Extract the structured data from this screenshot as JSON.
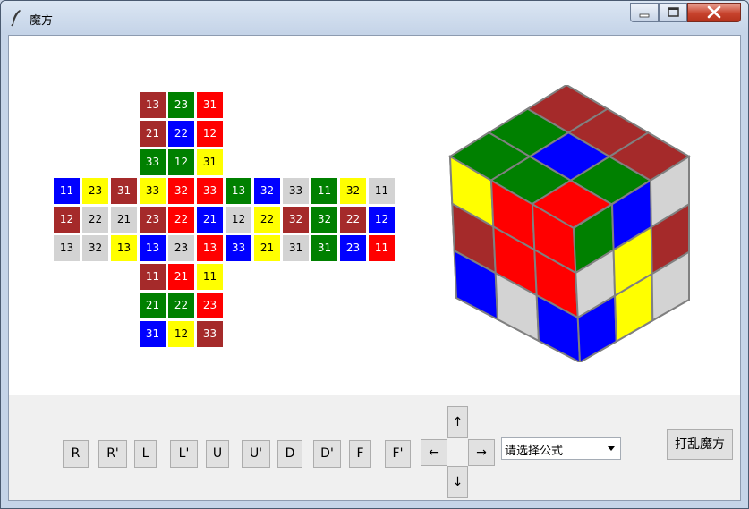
{
  "window": {
    "title": "魔方"
  },
  "net": {
    "rows": [
      {
        "row": 0,
        "col": 3,
        "cells": [
          {
            "t": "13",
            "c": "brown"
          },
          {
            "t": "23",
            "c": "green"
          },
          {
            "t": "31",
            "c": "red"
          }
        ]
      },
      {
        "row": 1,
        "col": 3,
        "cells": [
          {
            "t": "21",
            "c": "brown"
          },
          {
            "t": "22",
            "c": "blue"
          },
          {
            "t": "12",
            "c": "red"
          }
        ]
      },
      {
        "row": 2,
        "col": 3,
        "cells": [
          {
            "t": "33",
            "c": "green"
          },
          {
            "t": "12",
            "c": "green"
          },
          {
            "t": "31",
            "c": "yellow"
          }
        ]
      },
      {
        "row": 3,
        "col": 0,
        "cells": [
          {
            "t": "11",
            "c": "blue"
          },
          {
            "t": "23",
            "c": "yellow"
          },
          {
            "t": "31",
            "c": "brown"
          },
          {
            "t": "33",
            "c": "yellow"
          },
          {
            "t": "32",
            "c": "red"
          },
          {
            "t": "33",
            "c": "red"
          },
          {
            "t": "13",
            "c": "green"
          },
          {
            "t": "32",
            "c": "blue"
          },
          {
            "t": "33",
            "c": "gray"
          },
          {
            "t": "11",
            "c": "green"
          },
          {
            "t": "32",
            "c": "yellow"
          },
          {
            "t": "11",
            "c": "gray"
          }
        ]
      },
      {
        "row": 4,
        "col": 0,
        "cells": [
          {
            "t": "12",
            "c": "brown"
          },
          {
            "t": "22",
            "c": "gray"
          },
          {
            "t": "21",
            "c": "gray"
          },
          {
            "t": "23",
            "c": "brown"
          },
          {
            "t": "22",
            "c": "red"
          },
          {
            "t": "21",
            "c": "blue"
          },
          {
            "t": "12",
            "c": "gray"
          },
          {
            "t": "22",
            "c": "yellow"
          },
          {
            "t": "32",
            "c": "brown"
          },
          {
            "t": "32",
            "c": "green"
          },
          {
            "t": "22",
            "c": "brown"
          },
          {
            "t": "12",
            "c": "blue"
          }
        ]
      },
      {
        "row": 5,
        "col": 0,
        "cells": [
          {
            "t": "13",
            "c": "gray"
          },
          {
            "t": "32",
            "c": "gray"
          },
          {
            "t": "13",
            "c": "yellow"
          },
          {
            "t": "13",
            "c": "blue"
          },
          {
            "t": "23",
            "c": "gray"
          },
          {
            "t": "13",
            "c": "red"
          },
          {
            "t": "33",
            "c": "blue"
          },
          {
            "t": "21",
            "c": "yellow"
          },
          {
            "t": "31",
            "c": "gray"
          },
          {
            "t": "31",
            "c": "green"
          },
          {
            "t": "23",
            "c": "blue"
          },
          {
            "t": "11",
            "c": "red"
          }
        ]
      },
      {
        "row": 6,
        "col": 3,
        "cells": [
          {
            "t": "11",
            "c": "brown"
          },
          {
            "t": "21",
            "c": "red"
          },
          {
            "t": "11",
            "c": "yellow"
          }
        ]
      },
      {
        "row": 7,
        "col": 3,
        "cells": [
          {
            "t": "21",
            "c": "green"
          },
          {
            "t": "22",
            "c": "green"
          },
          {
            "t": "23",
            "c": "red"
          }
        ]
      },
      {
        "row": 8,
        "col": 3,
        "cells": [
          {
            "t": "31",
            "c": "blue"
          },
          {
            "t": "12",
            "c": "yellow"
          },
          {
            "t": "33",
            "c": "brown"
          }
        ]
      }
    ]
  },
  "cube3d": {
    "top": [
      "brown",
      "brown",
      "brown",
      "green",
      "blue",
      "green",
      "green",
      "green",
      "red",
      "red",
      "yellow",
      "red"
    ],
    "front": [
      "yellow",
      "red",
      "red",
      "brown",
      "red",
      "red",
      "blue",
      "gray",
      "blue",
      "gray",
      "red"
    ],
    "side": [
      "green",
      "blue",
      "gray",
      "gray",
      "yellow",
      "brown",
      "blue",
      "yellow",
      "gray"
    ]
  },
  "colors": {
    "brown": "#a52a2a",
    "green": "#008000",
    "red": "#ff0000",
    "blue": "#0000ff",
    "yellow": "#ffff00",
    "gray": "#d3d3d3",
    "frame": "#808080"
  },
  "controls": {
    "moves": [
      "R",
      "R'",
      "L",
      "L'",
      "U",
      "U'",
      "D",
      "D'",
      "F",
      "F'"
    ],
    "arrow_left": "←",
    "arrow_up": "↑",
    "arrow_right": "→",
    "arrow_down": "↓",
    "formula_placeholder": "请选择公式",
    "scramble_label": "打乱魔方"
  }
}
